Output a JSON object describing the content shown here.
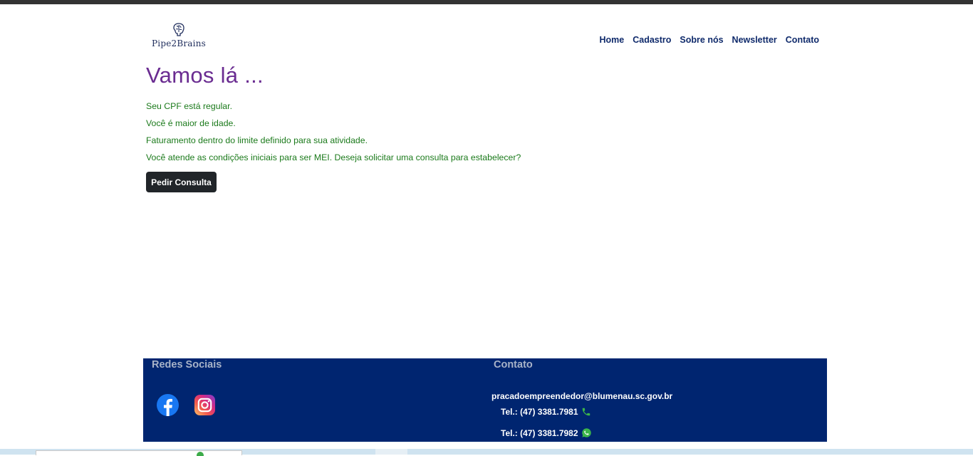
{
  "brand": {
    "name": "Pipe2Brains",
    "logo_icon": "brain-icon"
  },
  "nav": {
    "items": [
      "Home",
      "Cadastro",
      "Sobre nós",
      "Newsletter",
      "Contato"
    ]
  },
  "main": {
    "title": "Vamos lá  ...",
    "messages": [
      "Seu CPF está regular.",
      "Você é maior de idade.",
      "Faturamento dentro do limite definido para sua atividade.",
      "Você atende as condições iniciais para ser MEI. Deseja solicitar uma consulta para estabelecer?"
    ],
    "button_label": "Pedir Consulta"
  },
  "footer": {
    "social_title": "Redes Sociais",
    "social_icons": [
      "facebook-icon",
      "instagram-icon"
    ],
    "contact_title": "Contato",
    "email": "pracadoempreendedor@blumenau.sc.gov.br",
    "phones": [
      {
        "label": "Tel.: (47) 3381.7981",
        "icon": "phone-icon"
      },
      {
        "label": "Tel.: (47) 3381.7982",
        "icon": "whatsapp-icon"
      }
    ]
  },
  "colors": {
    "title": "#6a2c91",
    "messages": "#1b7a1b",
    "nav": "#0f2a6b",
    "footer_bg": "#002570",
    "button_bg": "#212529"
  }
}
